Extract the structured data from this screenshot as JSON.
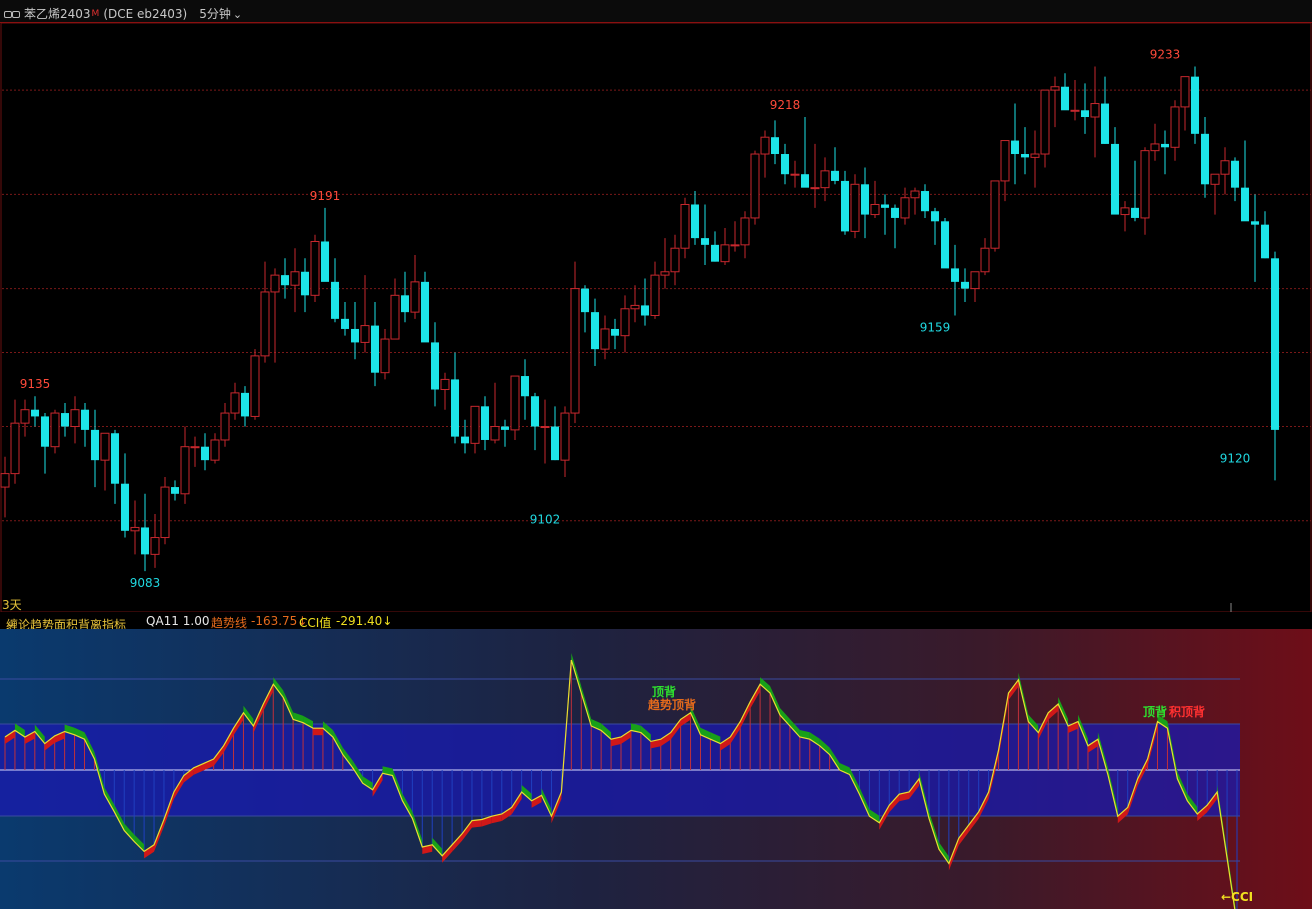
{
  "header": {
    "symbol": "苯乙烯2403",
    "badge": "M",
    "exchange_code": "(DCE eb2403)",
    "period": "5分钟",
    "period_chevron": "⌄"
  },
  "main_chart": {
    "price_range": [
      9078,
      9240
    ],
    "gridlines": [
      9098,
      9126,
      9148,
      9167,
      9195,
      9226
    ],
    "day_label": "3天",
    "annotations": [
      {
        "label": "9135",
        "index": 3,
        "price": 9135,
        "kind": "high"
      },
      {
        "label": "9083",
        "index": 14,
        "price": 9083,
        "kind": "low"
      },
      {
        "label": "9191",
        "index": 32,
        "price": 9191,
        "kind": "high"
      },
      {
        "label": "9102",
        "index": 54,
        "price": 9102,
        "kind": "low"
      },
      {
        "label": "9218",
        "index": 78,
        "price": 9218,
        "kind": "high"
      },
      {
        "label": "9159",
        "index": 93,
        "price": 9159,
        "kind": "low"
      },
      {
        "label": "9233",
        "index": 116,
        "price": 9233,
        "kind": "high"
      },
      {
        "label": "9120",
        "index": 123,
        "price": 9120,
        "kind": "low"
      }
    ]
  },
  "chart_data": {
    "type": "candlestick",
    "title": "苯乙烯2403 (DCE eb2403) 5分钟",
    "ylim": [
      9078,
      9240
    ],
    "candles": [
      [
        9108,
        9117,
        9099,
        9112
      ],
      [
        9112,
        9134,
        9109,
        9127
      ],
      [
        9127,
        9134,
        9123,
        9131
      ],
      [
        9131,
        9135,
        9126,
        9129
      ],
      [
        9129,
        9130,
        9112,
        9120
      ],
      [
        9120,
        9131,
        9118,
        9130
      ],
      [
        9130,
        9133,
        9123,
        9126
      ],
      [
        9126,
        9135,
        9121,
        9131
      ],
      [
        9131,
        9133,
        9120,
        9125
      ],
      [
        9125,
        9131,
        9108,
        9116
      ],
      [
        9116,
        9124,
        9107,
        9124
      ],
      [
        9124,
        9125,
        9103,
        9109
      ],
      [
        9109,
        9118,
        9093,
        9095
      ],
      [
        9095,
        9104,
        9088,
        9096
      ],
      [
        9096,
        9106,
        9083,
        9088
      ],
      [
        9088,
        9100,
        9084,
        9093
      ],
      [
        9093,
        9111,
        9091,
        9108
      ],
      [
        9108,
        9110,
        9104,
        9106
      ],
      [
        9106,
        9126,
        9103,
        9120
      ],
      [
        9120,
        9123,
        9114,
        9120
      ],
      [
        9120,
        9124,
        9113,
        9116
      ],
      [
        9116,
        9124,
        9115,
        9122
      ],
      [
        9122,
        9133,
        9120,
        9130
      ],
      [
        9130,
        9139,
        9128,
        9136
      ],
      [
        9136,
        9138,
        9126,
        9129
      ],
      [
        9129,
        9149,
        9128,
        9147
      ],
      [
        9147,
        9175,
        9145,
        9166
      ],
      [
        9166,
        9173,
        9145,
        9171
      ],
      [
        9171,
        9176,
        9164,
        9168
      ],
      [
        9168,
        9179,
        9160,
        9172
      ],
      [
        9172,
        9176,
        9160,
        9165
      ],
      [
        9165,
        9183,
        9163,
        9181
      ],
      [
        9181,
        9191,
        9170,
        9169
      ],
      [
        9169,
        9176,
        9157,
        9158
      ],
      [
        9158,
        9163,
        9153,
        9155
      ],
      [
        9155,
        9163,
        9146,
        9151
      ],
      [
        9151,
        9171,
        9148,
        9156
      ],
      [
        9156,
        9163,
        9138,
        9142
      ],
      [
        9142,
        9155,
        9140,
        9152
      ],
      [
        9152,
        9170,
        9152,
        9165
      ],
      [
        9165,
        9172,
        9157,
        9160
      ],
      [
        9160,
        9177,
        9158,
        9169
      ],
      [
        9169,
        9172,
        9152,
        9151
      ],
      [
        9151,
        9157,
        9132,
        9137
      ],
      [
        9137,
        9142,
        9131,
        9140
      ],
      [
        9140,
        9148,
        9121,
        9123
      ],
      [
        9123,
        9128,
        9118,
        9121
      ],
      [
        9121,
        9131,
        9118,
        9132
      ],
      [
        9132,
        9135,
        9119,
        9122
      ],
      [
        9122,
        9139,
        9121,
        9126
      ],
      [
        9126,
        9128,
        9120,
        9125
      ],
      [
        9125,
        9133,
        9122,
        9141
      ],
      [
        9141,
        9146,
        9128,
        9135
      ],
      [
        9135,
        9136,
        9119,
        9126
      ],
      [
        9126,
        9134,
        9115,
        9126
      ],
      [
        9126,
        9132,
        9116,
        9116
      ],
      [
        9116,
        9132,
        9111,
        9130
      ],
      [
        9130,
        9175,
        9127,
        9167
      ],
      [
        9167,
        9168,
        9154,
        9160
      ],
      [
        9160,
        9164,
        9144,
        9149
      ],
      [
        9149,
        9159,
        9146,
        9155
      ],
      [
        9155,
        9158,
        9149,
        9153
      ],
      [
        9153,
        9165,
        9148,
        9161
      ],
      [
        9161,
        9168,
        9157,
        9162
      ],
      [
        9162,
        9170,
        9156,
        9159
      ],
      [
        9159,
        9175,
        9158,
        9171
      ],
      [
        9171,
        9182,
        9167,
        9172
      ],
      [
        9172,
        9183,
        9168,
        9179
      ],
      [
        9179,
        9194,
        9176,
        9192
      ],
      [
        9192,
        9196,
        9180,
        9182
      ],
      [
        9182,
        9192,
        9174,
        9180
      ],
      [
        9180,
        9184,
        9175,
        9175
      ],
      [
        9175,
        9185,
        9174,
        9180
      ],
      [
        9180,
        9187,
        9178,
        9180
      ],
      [
        9180,
        9190,
        9176,
        9188
      ],
      [
        9188,
        9208,
        9186,
        9207
      ],
      [
        9207,
        9214,
        9200,
        9212
      ],
      [
        9212,
        9217,
        9204,
        9207
      ],
      [
        9207,
        9210,
        9198,
        9201
      ],
      [
        9201,
        9205,
        9197,
        9201
      ],
      [
        9201,
        9218,
        9200,
        9197
      ],
      [
        9197,
        9210,
        9191,
        9197
      ],
      [
        9197,
        9206,
        9193,
        9202
      ],
      [
        9202,
        9209,
        9198,
        9199
      ],
      [
        9199,
        9202,
        9183,
        9184
      ],
      [
        9184,
        9201,
        9182,
        9198
      ],
      [
        9198,
        9203,
        9182,
        9189
      ],
      [
        9189,
        9199,
        9188,
        9192
      ],
      [
        9192,
        9195,
        9183,
        9191
      ],
      [
        9191,
        9192,
        9179,
        9188
      ],
      [
        9188,
        9197,
        9186,
        9194
      ],
      [
        9194,
        9197,
        9189,
        9196
      ],
      [
        9196,
        9198,
        9188,
        9190
      ],
      [
        9190,
        9191,
        9180,
        9187
      ],
      [
        9187,
        9188,
        9176,
        9173
      ],
      [
        9173,
        9180,
        9159,
        9169
      ],
      [
        9169,
        9173,
        9163,
        9167
      ],
      [
        9167,
        9172,
        9163,
        9172
      ],
      [
        9172,
        9182,
        9171,
        9179
      ],
      [
        9179,
        9195,
        9178,
        9199
      ],
      [
        9199,
        9210,
        9193,
        9211
      ],
      [
        9211,
        9222,
        9198,
        9207
      ],
      [
        9207,
        9215,
        9201,
        9206
      ],
      [
        9206,
        9214,
        9197,
        9207
      ],
      [
        9207,
        9223,
        9203,
        9226
      ],
      [
        9226,
        9230,
        9215,
        9227
      ],
      [
        9227,
        9231,
        9221,
        9220
      ],
      [
        9220,
        9229,
        9217,
        9220
      ],
      [
        9220,
        9228,
        9213,
        9218
      ],
      [
        9218,
        9233,
        9206,
        9222
      ],
      [
        9222,
        9230,
        9210,
        9210
      ],
      [
        9210,
        9215,
        9193,
        9189
      ],
      [
        9189,
        9193,
        9184,
        9191
      ],
      [
        9191,
        9205,
        9187,
        9188
      ],
      [
        9188,
        9209,
        9183,
        9208
      ],
      [
        9208,
        9216,
        9205,
        9210
      ],
      [
        9210,
        9214,
        9201,
        9209
      ],
      [
        9209,
        9223,
        9205,
        9221
      ],
      [
        9221,
        9226,
        9214,
        9230
      ],
      [
        9230,
        9233,
        9210,
        9213
      ],
      [
        9213,
        9218,
        9194,
        9198
      ],
      [
        9198,
        9201,
        9189,
        9201
      ],
      [
        9201,
        9209,
        9195,
        9205
      ],
      [
        9205,
        9206,
        9193,
        9197
      ],
      [
        9197,
        9211,
        9194,
        9187
      ],
      [
        9187,
        9195,
        9169,
        9186
      ],
      [
        9186,
        9190,
        9176,
        9176
      ],
      [
        9176,
        9178,
        9110,
        9125
      ]
    ]
  },
  "indicator": {
    "name": "缠论趋势面积背离指标",
    "name_chevron": "⌄",
    "param": "QA11 1.00",
    "trend_label": "趋势线",
    "trend_value": "-163.75↓",
    "cci_label": "CCI值",
    "cci_value": "-291.40↓",
    "labels": {
      "top_div_1": "顶背",
      "trend_top_div": "趋势顶背",
      "top_div_2": "顶背",
      "area_div": "积顶背",
      "cci_tag": "←CCI"
    },
    "cci_series": [
      30,
      36,
      30,
      35,
      24,
      31,
      35,
      32,
      28,
      10,
      -22,
      -38,
      -55,
      -65,
      -74,
      -68,
      -45,
      -20,
      -5,
      2,
      6,
      10,
      22,
      38,
      52,
      40,
      60,
      78,
      66,
      46,
      43,
      38,
      38,
      30,
      14,
      2,
      -12,
      -18,
      -3,
      -5,
      -28,
      -44,
      -70,
      -68,
      -78,
      -68,
      -58,
      -46,
      -45,
      -42,
      -40,
      -34,
      -20,
      -28,
      -23,
      -42,
      -20,
      100,
      70,
      40,
      36,
      28,
      30,
      36,
      34,
      26,
      28,
      34,
      46,
      52,
      32,
      28,
      24,
      30,
      44,
      62,
      78,
      70,
      50,
      40,
      30,
      28,
      22,
      14,
      0,
      -4,
      -22,
      -42,
      -48,
      -32,
      -22,
      -20,
      -8,
      -44,
      -72,
      -85,
      -62,
      -50,
      -38,
      -20,
      18,
      70,
      82,
      44,
      34,
      52,
      60,
      40,
      44,
      22,
      28,
      -4,
      -42,
      -34,
      -8,
      10,
      44,
      38,
      -8,
      -28,
      -40,
      -32,
      -20,
      -80,
      -140
    ]
  },
  "colors": {
    "up": "#c8282e",
    "down": "#1de4e8",
    "grid": "#7a1818",
    "label_high": "#ff4a3a",
    "label_low": "#20d8e0"
  }
}
